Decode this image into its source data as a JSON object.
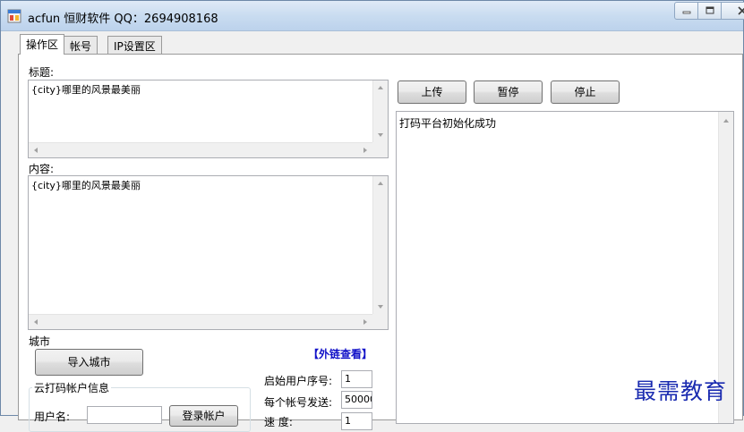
{
  "window": {
    "title": "acfun  恒财软件 QQ：2694908168"
  },
  "tabs": [
    {
      "label": "操作区",
      "active": true
    },
    {
      "label": "帐号",
      "active": false
    },
    {
      "label": "IP设置区",
      "active": false
    }
  ],
  "form": {
    "title_label": "标题:",
    "title_value": "{city}哪里的风景最美丽",
    "content_label": "内容:",
    "content_value": "{city}哪里的风景最美丽",
    "city_label": "城市",
    "import_city_button": "导入城市",
    "external_link": "【外链查看】",
    "cloud_group_title": "云打码帐户信息",
    "username_label": "用户名:",
    "username_value": "",
    "login_button": "登录帐户",
    "start_index_label": "启始用户序号:",
    "start_index_value": "1",
    "per_account_label": "每个帐号发送:",
    "per_account_value": "50000",
    "third_label": "速     度:",
    "third_value": "1"
  },
  "actions": {
    "upload": "上传",
    "pause": "暂停",
    "stop": "停止"
  },
  "log": {
    "lines": [
      "打码平台初始化成功"
    ]
  },
  "watermark": "最需教育"
}
